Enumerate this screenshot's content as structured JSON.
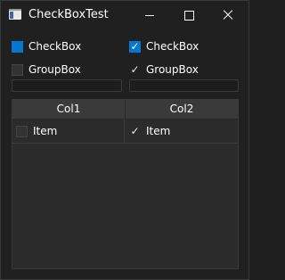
{
  "window": {
    "title": "CheckBoxTest"
  },
  "left_column": {
    "checkbox_label": "CheckBox",
    "groupbox_label": "GroupBox"
  },
  "right_column": {
    "checkbox_label": "CheckBox",
    "groupbox_label": "GroupBox"
  },
  "table": {
    "columns": [
      "Col1",
      "Col2"
    ],
    "rows": [
      {
        "col1": "Item",
        "col2": "Item",
        "col1_checked": false,
        "col2_checked": true
      }
    ]
  },
  "colors": {
    "accent": "#0078d4",
    "background": "#202020"
  },
  "icons": {
    "check": "✓"
  }
}
